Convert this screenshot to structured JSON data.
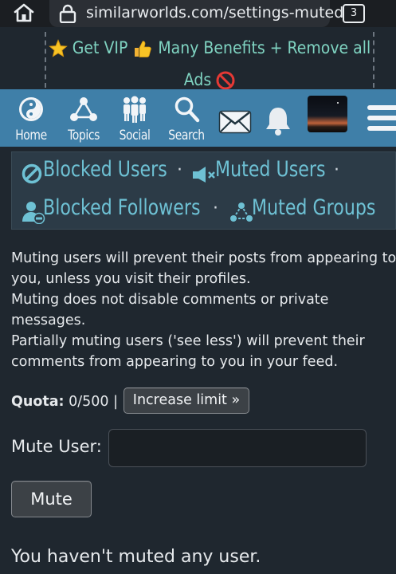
{
  "browser": {
    "url": "similarworlds.com/settings-muted",
    "tab_count": "3"
  },
  "vip_banner": {
    "line1_text": "Get VIP",
    "line1_text2": "Many Benefits + Remove all",
    "line2_text": "Ads"
  },
  "nav": {
    "items": [
      {
        "label": "Home",
        "icon": "yin-yang-icon"
      },
      {
        "label": "Topics",
        "icon": "topics-icon"
      },
      {
        "label": "Social",
        "icon": "social-people-icon"
      },
      {
        "label": "Search",
        "icon": "search-icon"
      },
      {
        "label": "",
        "icon": "mail-icon"
      },
      {
        "label": "",
        "icon": "bell-icon"
      },
      {
        "label": "",
        "icon": "avatar"
      },
      {
        "label": "",
        "icon": "hamburger-menu-icon"
      }
    ]
  },
  "settings_menu": {
    "blocked_users": "Blocked Users",
    "muted_users": "Muted Users",
    "blocked_followers": "Blocked Followers",
    "muted_groups": "Muted Groups",
    "separator": "·"
  },
  "description": {
    "lines": [
      "Muting users will prevent their posts from appearing to",
      "you, unless you visit their profiles.",
      "Muting does not disable comments or private",
      "messages.",
      "Partially muting users ('see less') will prevent their",
      "comments from appearing to you in your feed."
    ]
  },
  "quota": {
    "label": "Quota:",
    "value": "0/500",
    "separator": "|",
    "increase_button": "Increase limit »"
  },
  "mute_form": {
    "label": "Mute User:",
    "input_value": "",
    "button_label": "Mute"
  },
  "empty_message": "You haven't muted any user.",
  "colors": {
    "page_bg": "#1f272f",
    "nav_bg": "#3f7fa8",
    "link": "#6ec1d4",
    "vip_text": "#7fd3c1"
  }
}
